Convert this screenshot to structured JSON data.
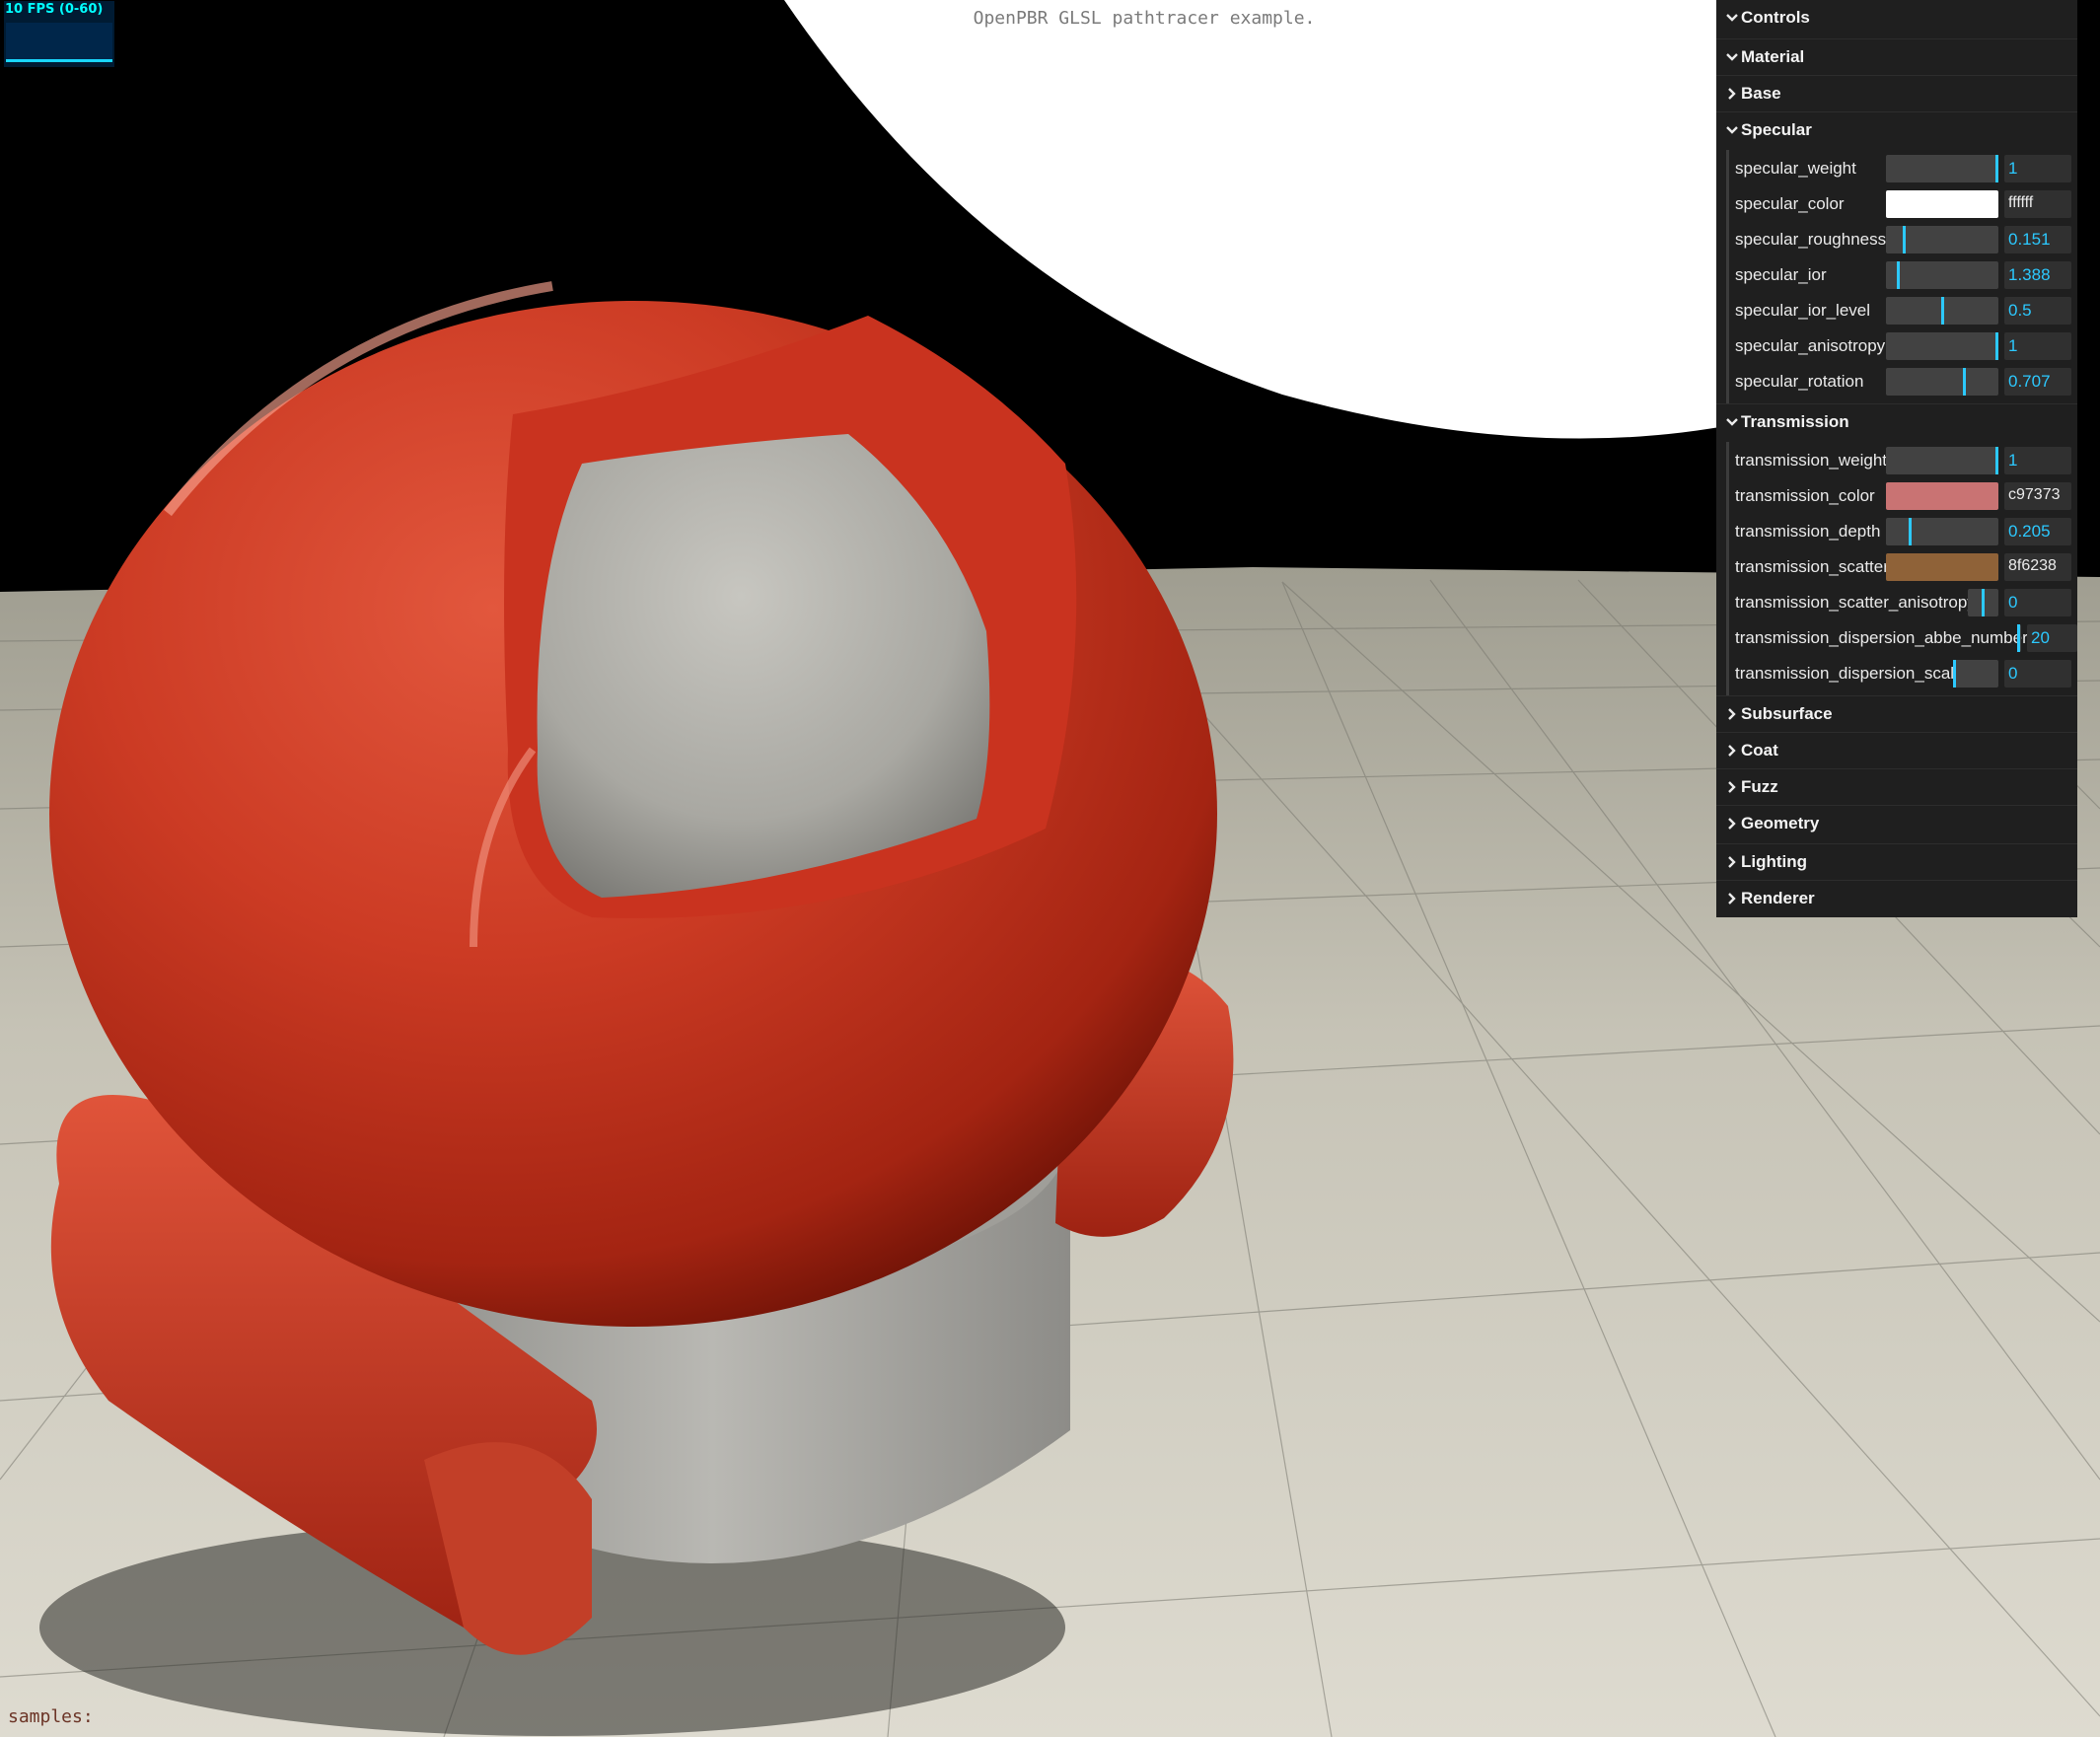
{
  "title": "OpenPBR GLSL pathtracer example.",
  "fps": {
    "label": "10 FPS (0-60)",
    "color": "#00ffff"
  },
  "status": {
    "samples_label": "samples:"
  },
  "panel": {
    "title": "Controls",
    "material": "Material",
    "base": "Base",
    "specular": {
      "label": "Specular",
      "rows": [
        {
          "name": "specular_weight",
          "value": "1",
          "fraction": 1.0
        },
        {
          "name": "specular_color",
          "value": "ffffff",
          "color": "#ffffff"
        },
        {
          "name": "specular_roughness",
          "value": "0.151",
          "fraction": 0.151
        },
        {
          "name": "specular_ior",
          "value": "1.388",
          "fraction": 0.097
        },
        {
          "name": "specular_ior_level",
          "value": "0.5",
          "fraction": 0.5
        },
        {
          "name": "specular_anisotropy",
          "value": "1",
          "fraction": 1.0
        },
        {
          "name": "specular_rotation",
          "value": "0.707",
          "fraction": 0.707
        }
      ]
    },
    "transmission": {
      "label": "Transmission",
      "rows": [
        {
          "name": "transmission_weight",
          "value": "1",
          "fraction": 1.0
        },
        {
          "name": "transmission_color",
          "value": "c97373",
          "color": "#c97373"
        },
        {
          "name": "transmission_depth",
          "value": "0.205",
          "fraction": 0.205
        },
        {
          "name": "transmission_scatter",
          "value": "8f6238",
          "color": "#8f6238"
        },
        {
          "name": "transmission_scatter_anisotropy",
          "value": "0",
          "fraction": 0.5
        },
        {
          "name": "transmission_dispersion_abbe_number",
          "value": "20",
          "fraction": 0.0
        },
        {
          "name": "transmission_dispersion_scale",
          "value": "0",
          "fraction": 0.0
        }
      ]
    },
    "subsurface": "Subsurface",
    "coat": "Coat",
    "fuzz": "Fuzz",
    "geometry": "Geometry",
    "lighting": "Lighting",
    "renderer": "Renderer"
  }
}
